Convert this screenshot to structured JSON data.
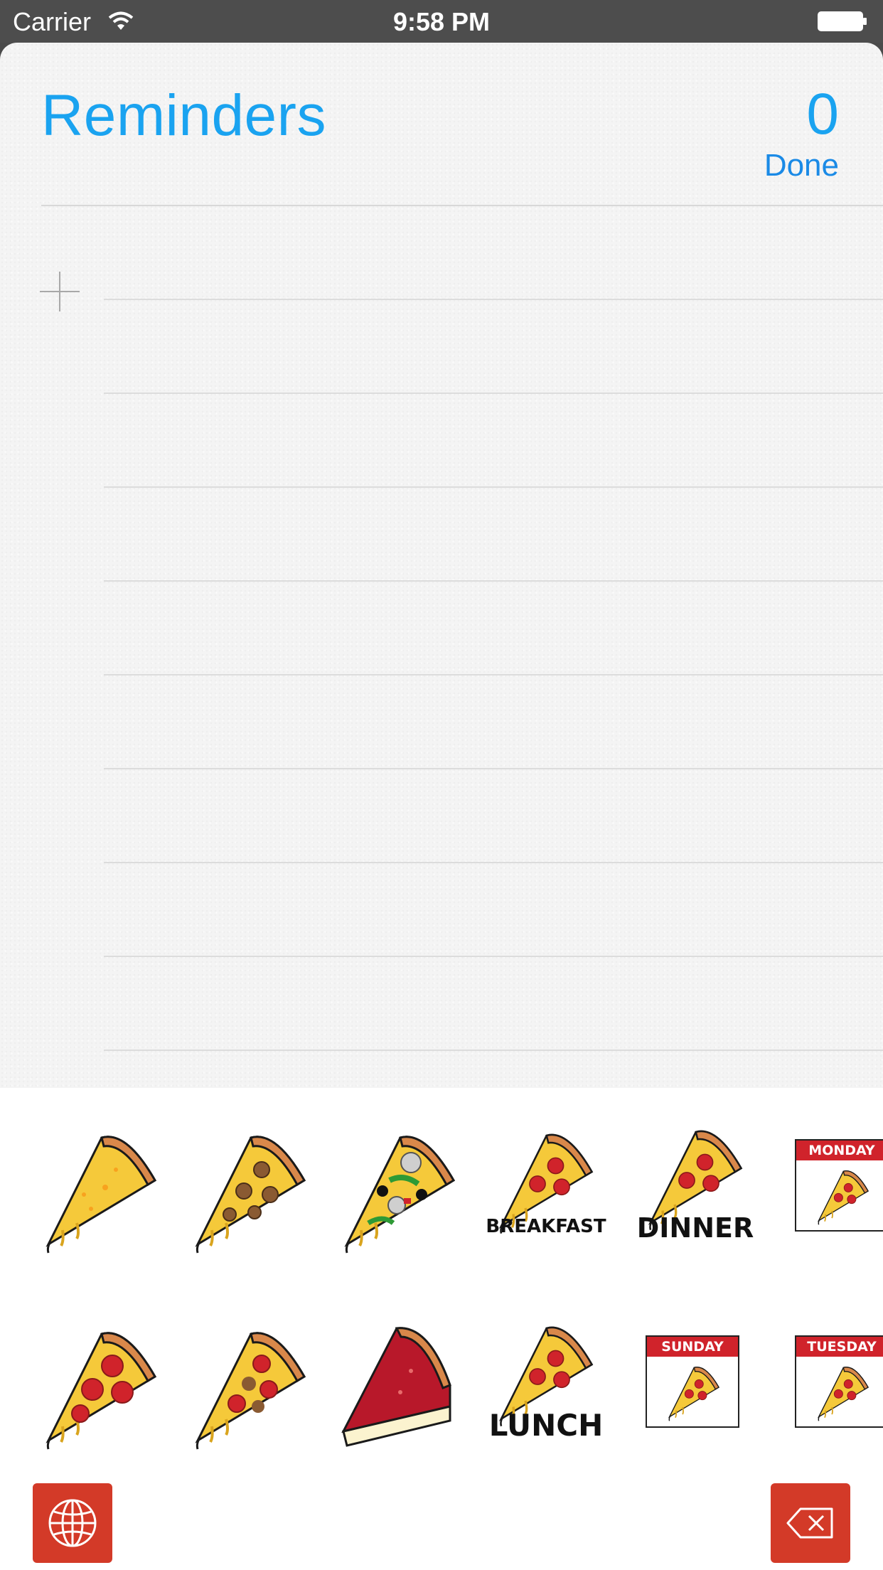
{
  "status_bar": {
    "carrier": "Carrier",
    "time": "9:58 PM"
  },
  "reminders": {
    "title": "Reminders",
    "count": "0",
    "done_label": "Done"
  },
  "stickers": {
    "breakfast": "BREAKFAST",
    "dinner": "DINNER",
    "lunch": "LUNCH",
    "monday": "MONDAY",
    "sunday": "SUNDAY",
    "tuesday": "TUESDAY"
  },
  "colors": {
    "accent": "#1aa3f0",
    "keyboard_button": "#d33a28",
    "calendar_red": "#d0232b"
  },
  "icons": {
    "globe": "globe-icon",
    "backspace": "backspace-icon",
    "add": "plus-icon"
  }
}
